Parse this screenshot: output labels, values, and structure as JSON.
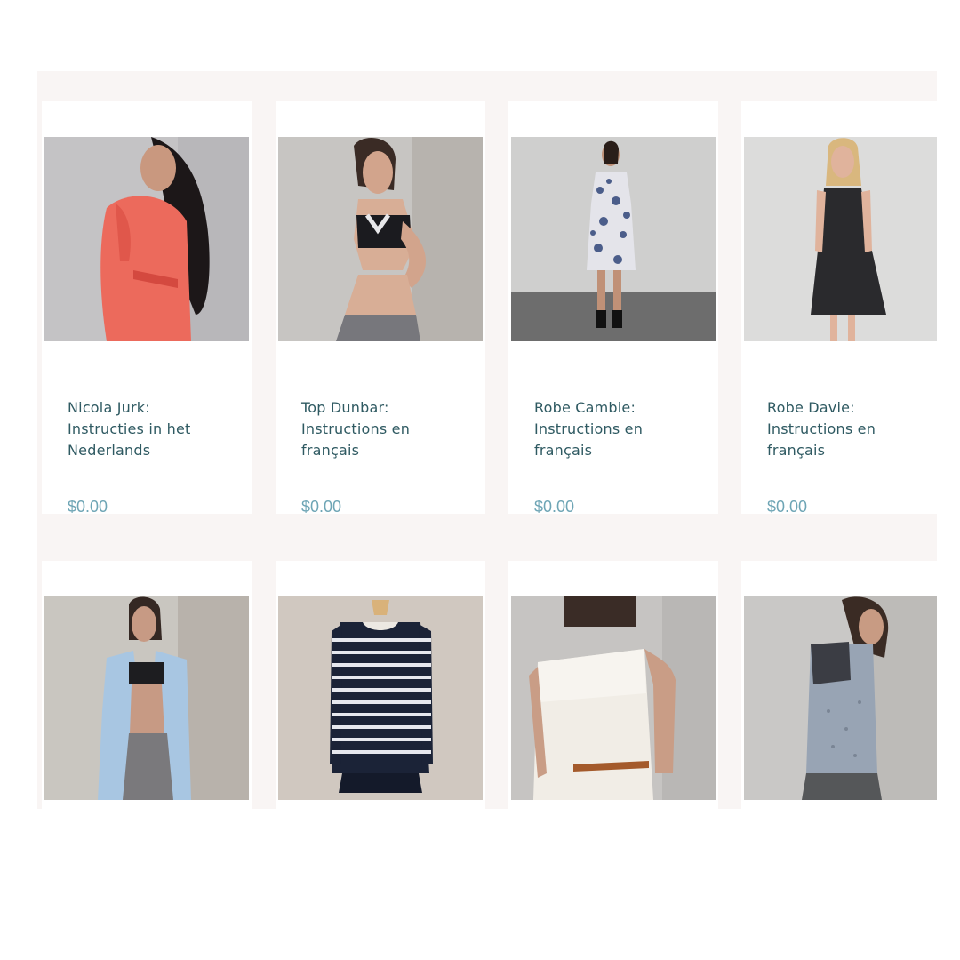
{
  "products": [
    {
      "title_lines": [
        "Nicola Jurk:",
        "Instructies in het",
        "Nederlands"
      ],
      "price": "$0.00",
      "image": "woman-coral-wrap-dress"
    },
    {
      "title_lines": [
        "Top Dunbar:",
        "Instructions en",
        "français"
      ],
      "price": "$0.00",
      "image": "woman-sports-bra-leggings"
    },
    {
      "title_lines": [
        "Robe Cambie:",
        "Instructions en",
        "français"
      ],
      "price": "$0.00",
      "image": "woman-floral-dress"
    },
    {
      "title_lines": [
        "Robe Davie:",
        "Instructions en",
        "français"
      ],
      "price": "$0.00",
      "image": "woman-black-dress"
    },
    {
      "image": "woman-blue-jacket"
    },
    {
      "image": "striped-top-on-dress-form"
    },
    {
      "image": "woman-white-dress-back"
    },
    {
      "image": "woman-grey-sweatshirt"
    }
  ]
}
